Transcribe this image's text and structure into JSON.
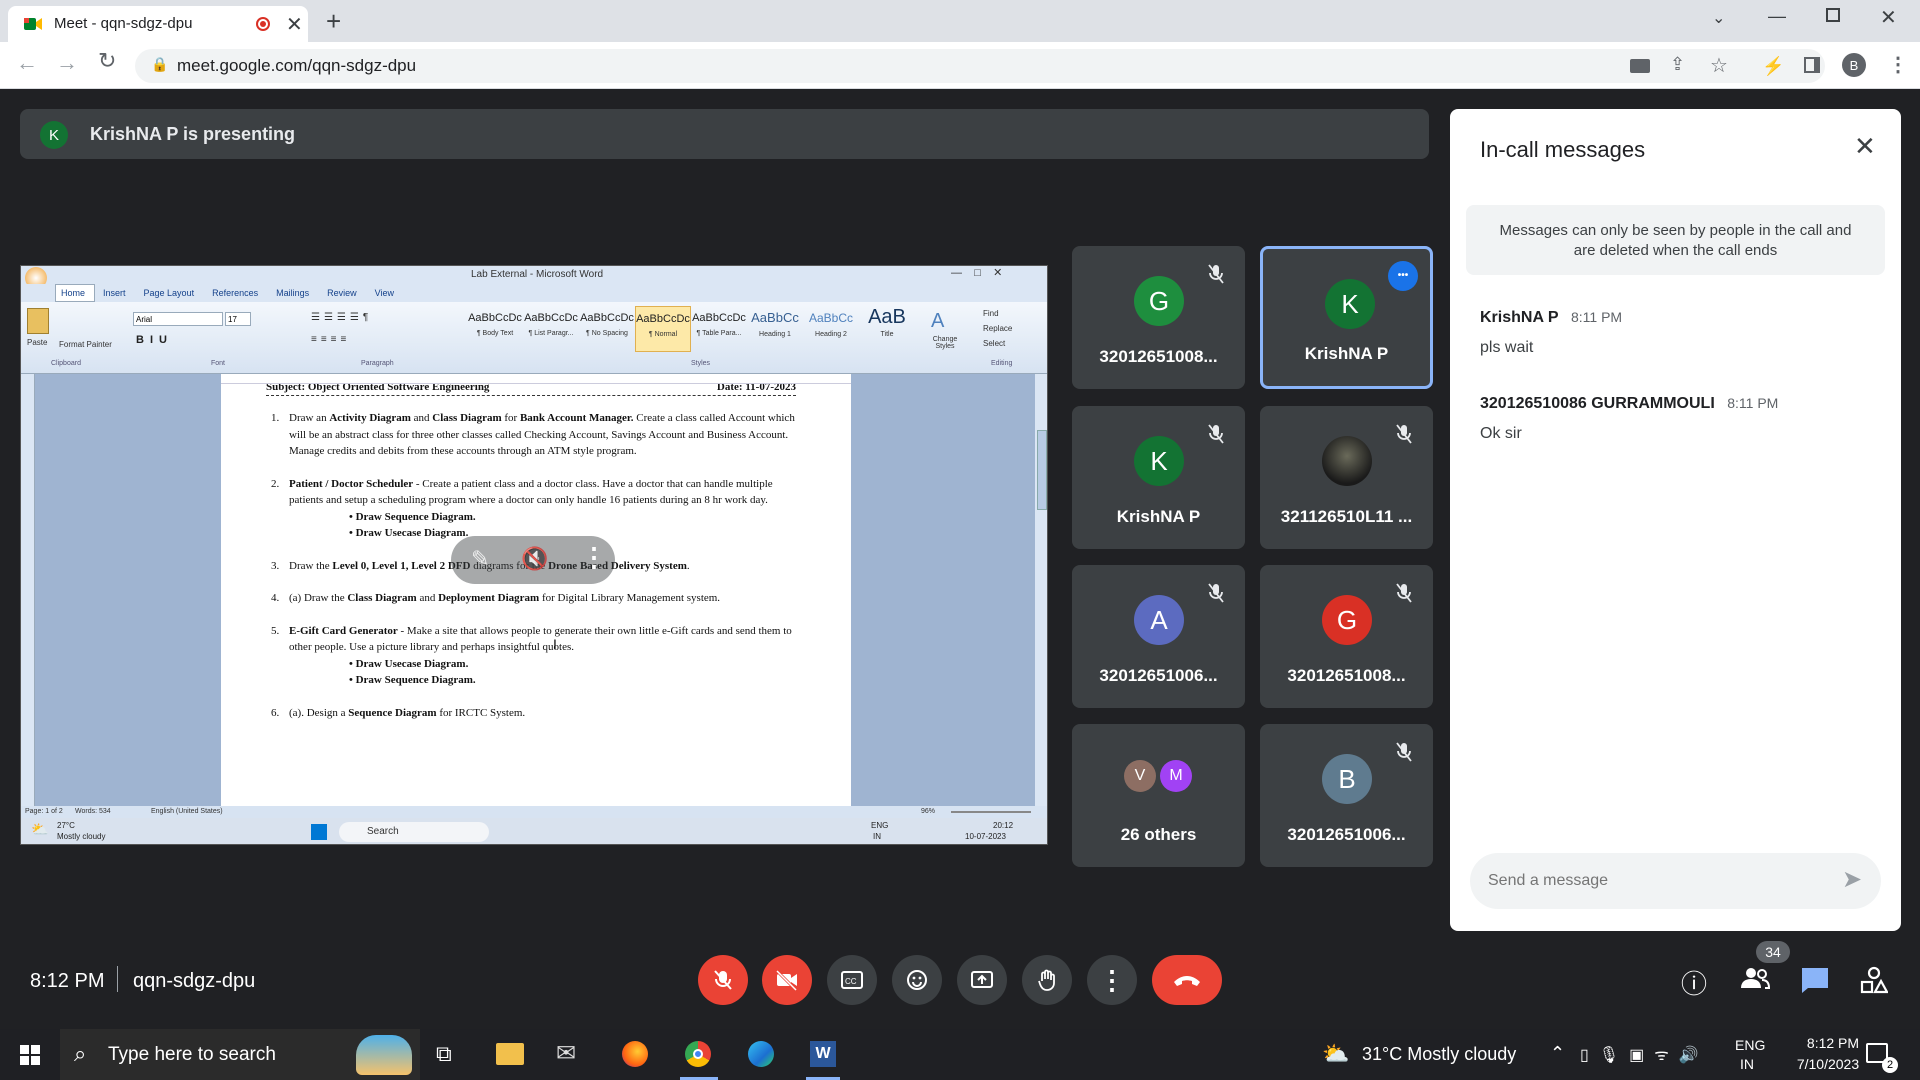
{
  "browser": {
    "tab_title": "Meet - qqn-sdgz-dpu",
    "url": "meet.google.com/qqn-sdgz-dpu",
    "profile_initial": "B"
  },
  "banner": {
    "initial": "K",
    "text": "KrishNA P is presenting"
  },
  "word": {
    "title": "Lab External - Microsoft Word",
    "ribbon_tabs": [
      "Home",
      "Insert",
      "Page Layout",
      "References",
      "Mailings",
      "Review",
      "View"
    ],
    "font_name": "Arial",
    "font_size": "17",
    "styles": [
      {
        "preview": "AaBbCcDc",
        "label": "¶ Body Text"
      },
      {
        "preview": "AaBbCcDc",
        "label": "¶ List Paragr..."
      },
      {
        "preview": "AaBbCcDc",
        "label": "¶ No Spacing"
      },
      {
        "preview": "AaBbCcDc",
        "label": "¶ Normal"
      },
      {
        "preview": "AaBbCcDc",
        "label": "¶ Table Para..."
      },
      {
        "preview": "AaBbCc",
        "label": "Heading 1"
      },
      {
        "preview": "AaBbCc",
        "label": "Heading 2"
      },
      {
        "preview": "AaB",
        "label": "Title"
      }
    ],
    "group_labels": [
      "Clipboard",
      "Font",
      "Paragraph",
      "Styles",
      "Editing"
    ],
    "change_styles": "Change Styles",
    "editing": [
      "Find",
      "Replace",
      "Select"
    ],
    "clipboard": {
      "paste": "Paste",
      "format_painter": "Format Painter"
    },
    "doc_header_left": "Subject: Object Oriented Software Engineering",
    "doc_header_right": "Date: 11-07-2023",
    "items": [
      {
        "num": "1.",
        "html": "Draw an <b>Activity Diagram</b> and <b>Class Diagram</b> for <b>Bank Account Manager.</b> Create a class called Account which will be an abstract class for three other classes called Checking Account, Savings Account and Business Account. Manage credits and debits from these accounts through an ATM style program."
      },
      {
        "num": "2.",
        "html": "<b>Patient / Doctor Scheduler</b> - Create a patient class and a doctor class. Have a doctor that can handle multiple patients and setup a scheduling program where a doctor can only handle 16 patients during an 8 hr work day.",
        "bullets": [
          "Draw Sequence Diagram.",
          "Draw Usecase Diagram."
        ]
      },
      {
        "num": "3.",
        "html": "Draw the <b>Level 0, Level 1, Level 2 DFD</b> diagrams for the <b>Drone Based Delivery System</b>."
      },
      {
        "num": "4.",
        "html": "(a) Draw the <b>Class Diagram</b> and <b>Deployment Diagram</b> for Digital Library Management system."
      },
      {
        "num": "5.",
        "html": "<b>E-Gift Card Generator</b> - Make a site that allows people to generate their own little e-Gift cards and send them to other people. Use a picture library and perhaps insightful quotes.",
        "bullets": [
          "Draw Usecase Diagram.",
          "Draw Sequence Diagram."
        ]
      },
      {
        "num": "6.",
        "html": "(a). Design a <b>Sequence Diagram</b> for IRCTC System."
      }
    ],
    "status": {
      "page": "Page: 1 of 2",
      "words": "Words: 534",
      "language": "English (United States)",
      "zoom": "96%"
    },
    "inner_taskbar": {
      "weather_temp": "27°C",
      "weather_text": "Mostly cloudy",
      "search": "Search",
      "lang1": "ENG",
      "lang2": "IN",
      "time": "20:12",
      "date": "10-07-2023"
    }
  },
  "participants": [
    {
      "initial": "G",
      "color": "#1e8e3e",
      "name": "32012651008..."
    },
    {
      "initial": "K",
      "color": "#137333",
      "name": "KrishNA P",
      "active": true
    },
    {
      "initial": "K",
      "color": "#137333",
      "name": "KrishNA P"
    },
    {
      "initial": "",
      "color": "#2d2d2d",
      "name": "321126510L11 ...",
      "photo": true
    },
    {
      "initial": "A",
      "color": "#5c6bc0",
      "name": "32012651006..."
    },
    {
      "initial": "G",
      "color": "#d93025",
      "name": "32012651008..."
    },
    {
      "initial": "",
      "color": "",
      "name": "26 others",
      "others": [
        "V",
        "M"
      ]
    },
    {
      "initial": "B",
      "color": "#5f7b8f",
      "name": "32012651006..."
    }
  ],
  "panel": {
    "title": "In-call messages",
    "notice": "Messages can only be seen by people in the call and are deleted when the call ends",
    "messages": [
      {
        "sender": "KrishNA P",
        "time": "8:11 PM",
        "text": "pls wait"
      },
      {
        "sender": "320126510086 GURRAMMOULI",
        "time": "8:11 PM",
        "text": "Ok sir"
      }
    ],
    "input_placeholder": "Send a message"
  },
  "bottom": {
    "time": "8:12 PM",
    "meeting_code": "qqn-sdgz-dpu",
    "people_count": "34"
  },
  "taskbar": {
    "search": "Type here to search",
    "weather": "31°C  Mostly cloudy",
    "lang1": "ENG",
    "lang2": "IN",
    "time": "8:12 PM",
    "date": "7/10/2023",
    "notif_count": "2"
  },
  "colors": {
    "meet_bg": "#202124",
    "tile_bg": "#3c4043",
    "end_call": "#ea4335",
    "accent": "#8ab4f8",
    "chat_active": "#4285f4"
  }
}
